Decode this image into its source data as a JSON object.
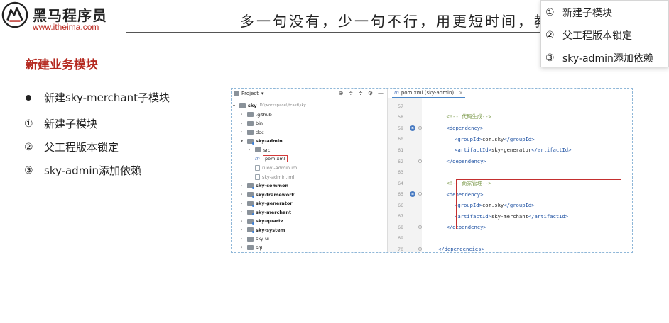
{
  "header": {
    "logo_name": "黑马程序员",
    "logo_url": "www.itheima.com",
    "slogan": "多一句没有，少一句不行，用更短时间，教会"
  },
  "popup": {
    "items": [
      {
        "num": "①",
        "label": "新建子模块"
      },
      {
        "num": "②",
        "label": "父工程版本锁定"
      },
      {
        "num": "③",
        "label": "sky-admin添加依赖"
      }
    ]
  },
  "section_title": "新建业务模块",
  "bullets": {
    "main": "新建sky-merchant子模块",
    "steps": [
      {
        "num": "①",
        "label": "新建子模块"
      },
      {
        "num": "②",
        "label": "父工程版本锁定"
      },
      {
        "num": "③",
        "label": "sky-admin添加依赖"
      }
    ]
  },
  "ide": {
    "project_title": "Project",
    "project_dropdown": "▾",
    "toolbar_icons": [
      "⊕",
      "≑",
      "≑",
      "⚙",
      "—"
    ],
    "tree": [
      {
        "indent": 0,
        "arrow": "▾",
        "icon": "folder",
        "name": "sky",
        "path": "D:\\workspace\\itcast\\sky",
        "bold": true
      },
      {
        "indent": 1,
        "arrow": "›",
        "icon": "folder",
        "name": ".github"
      },
      {
        "indent": 1,
        "arrow": "›",
        "icon": "folder",
        "name": "bin"
      },
      {
        "indent": 1,
        "arrow": "›",
        "icon": "folder",
        "name": "doc"
      },
      {
        "indent": 1,
        "arrow": "▾",
        "icon": "mfolder",
        "name": "sky-admin",
        "bold": true
      },
      {
        "indent": 2,
        "arrow": "›",
        "icon": "folder",
        "name": "src"
      },
      {
        "indent": 2,
        "arrow": "",
        "icon": "mfile",
        "name": "pom.xml",
        "highlight": true
      },
      {
        "indent": 2,
        "arrow": "",
        "icon": "file",
        "name": "ruoyi-admin.iml",
        "grey": true
      },
      {
        "indent": 2,
        "arrow": "",
        "icon": "file",
        "name": "sky-admin.iml",
        "grey": true
      },
      {
        "indent": 1,
        "arrow": "›",
        "icon": "mfolder",
        "name": "sky-common",
        "bold": true
      },
      {
        "indent": 1,
        "arrow": "›",
        "icon": "mfolder",
        "name": "sky-framework",
        "bold": true
      },
      {
        "indent": 1,
        "arrow": "›",
        "icon": "mfolder",
        "name": "sky-generator",
        "bold": true
      },
      {
        "indent": 1,
        "arrow": "›",
        "icon": "mfolder",
        "name": "sky-merchant",
        "bold": true
      },
      {
        "indent": 1,
        "arrow": "›",
        "icon": "mfolder",
        "name": "sky-quartz",
        "bold": true
      },
      {
        "indent": 1,
        "arrow": "›",
        "icon": "mfolder",
        "name": "sky-system",
        "bold": true
      },
      {
        "indent": 1,
        "arrow": "›",
        "icon": "folder",
        "name": "sky-ui"
      },
      {
        "indent": 1,
        "arrow": "›",
        "icon": "folder",
        "name": "sql"
      }
    ],
    "tab": {
      "icon": "m",
      "label": "pom.xml (sky-admin)",
      "close": "×"
    },
    "code_lines": [
      {
        "ln": "57",
        "parts": []
      },
      {
        "ln": "58",
        "indent": 3,
        "parts": [
          {
            "t": "<!-- 代码生成-->",
            "c": "cmt"
          }
        ]
      },
      {
        "ln": "59",
        "indent": 3,
        "mvn": true,
        "fold": true,
        "parts": [
          {
            "t": "<dependency>",
            "c": "tag"
          }
        ]
      },
      {
        "ln": "60",
        "indent": 4,
        "parts": [
          {
            "t": "<groupId>",
            "c": "tag"
          },
          {
            "t": "com.sky",
            "c": "txt"
          },
          {
            "t": "</groupId>",
            "c": "tag"
          }
        ]
      },
      {
        "ln": "61",
        "indent": 4,
        "parts": [
          {
            "t": "<artifactId>",
            "c": "tag"
          },
          {
            "t": "sky-generator",
            "c": "txt"
          },
          {
            "t": "</artifactId>",
            "c": "tag"
          }
        ]
      },
      {
        "ln": "62",
        "indent": 3,
        "fold": true,
        "parts": [
          {
            "t": "</dependency>",
            "c": "tag"
          }
        ]
      },
      {
        "ln": "63",
        "parts": []
      },
      {
        "ln": "64",
        "indent": 3,
        "parts": [
          {
            "t": "<!--  商家管理-->",
            "c": "cmt"
          }
        ]
      },
      {
        "ln": "65",
        "indent": 3,
        "mvn": true,
        "fold": true,
        "parts": [
          {
            "t": "<dependency>",
            "c": "tag"
          }
        ]
      },
      {
        "ln": "66",
        "indent": 4,
        "parts": [
          {
            "t": "<groupId>",
            "c": "tag"
          },
          {
            "t": "com.sky",
            "c": "txt"
          },
          {
            "t": "</groupId>",
            "c": "tag"
          }
        ]
      },
      {
        "ln": "67",
        "indent": 4,
        "parts": [
          {
            "t": "<artifactId>",
            "c": "tag"
          },
          {
            "t": "sky-merchant",
            "c": "txt"
          },
          {
            "t": "</artifactId>",
            "c": "tag"
          }
        ]
      },
      {
        "ln": "68",
        "indent": 3,
        "fold": true,
        "parts": [
          {
            "t": "</dependency>",
            "c": "tag"
          }
        ]
      },
      {
        "ln": "69",
        "parts": []
      },
      {
        "ln": "70",
        "indent": 2,
        "fold": true,
        "parts": [
          {
            "t": "</dependencies>",
            "c": "tag"
          }
        ]
      }
    ]
  },
  "colors": {
    "brand_red": "#b52a21",
    "tag_blue": "#1f52a3",
    "comment_green": "#7d9b4d",
    "highlight_red": "#c42f2f"
  }
}
